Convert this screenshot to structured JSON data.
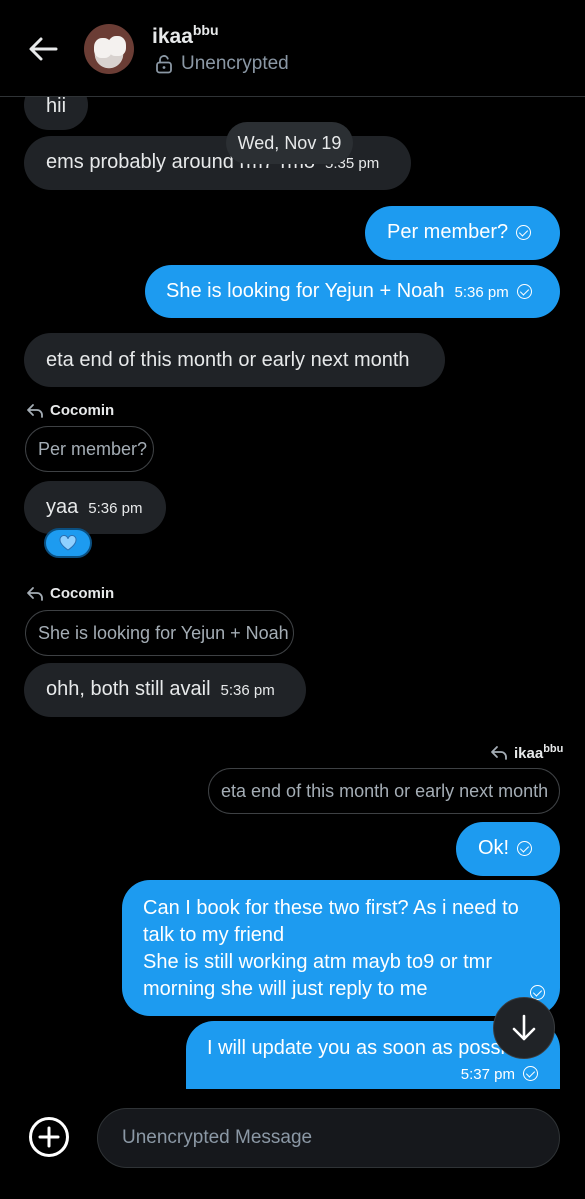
{
  "header": {
    "name": "ikaa",
    "name_sup": "bbu",
    "encryption_status": "Unencrypted"
  },
  "date_separator": "Wed, Nov 19",
  "messages": [
    {
      "dir": "in",
      "text": "hii",
      "time": ""
    },
    {
      "dir": "in",
      "text": "ems probably around rm7-rm8",
      "time": "5:35 pm"
    },
    {
      "dir": "out",
      "text": "Per member?",
      "time": ""
    },
    {
      "dir": "out",
      "text": "She is looking for Yejun + Noah",
      "time": "5:36 pm"
    },
    {
      "dir": "in",
      "text": "eta end of this month or early next month",
      "time": ""
    },
    {
      "dir": "in",
      "reply_to_name": "Cocomin",
      "reply_quote": "Per member?",
      "text": "yaa",
      "time": "5:36 pm",
      "reaction": "blue-heart"
    },
    {
      "dir": "in",
      "reply_to_name": "Cocomin",
      "reply_quote": "She is looking for Yejun + Noah",
      "text": "ohh, both still avail",
      "time": "5:36 pm"
    },
    {
      "dir": "out",
      "reply_to_name": "ikaa",
      "reply_to_name_sup": "bbu",
      "reply_quote": "eta end of this month or early next month",
      "text": "Ok!",
      "time": ""
    },
    {
      "dir": "out",
      "lines": [
        "Can I book for these two first? As i need to",
        "talk to my friend",
        "She is still working atm mayb to9 or tmr",
        "morning she will just reply to me"
      ],
      "time": ""
    },
    {
      "dir": "out",
      "text": "I will update you as soon as possi",
      "time": "5:37 pm"
    }
  ],
  "composer": {
    "placeholder": "Unencrypted Message"
  },
  "icons": {
    "back": "arrow-left-icon",
    "lock": "unlock-icon",
    "reply": "reply-arrow-icon",
    "read": "check-circle-icon",
    "scroll": "arrow-down-icon",
    "add": "plus-circle-icon"
  },
  "colors": {
    "accent": "#1d9bf0",
    "incoming_bubble": "#202327",
    "background": "#000000"
  }
}
